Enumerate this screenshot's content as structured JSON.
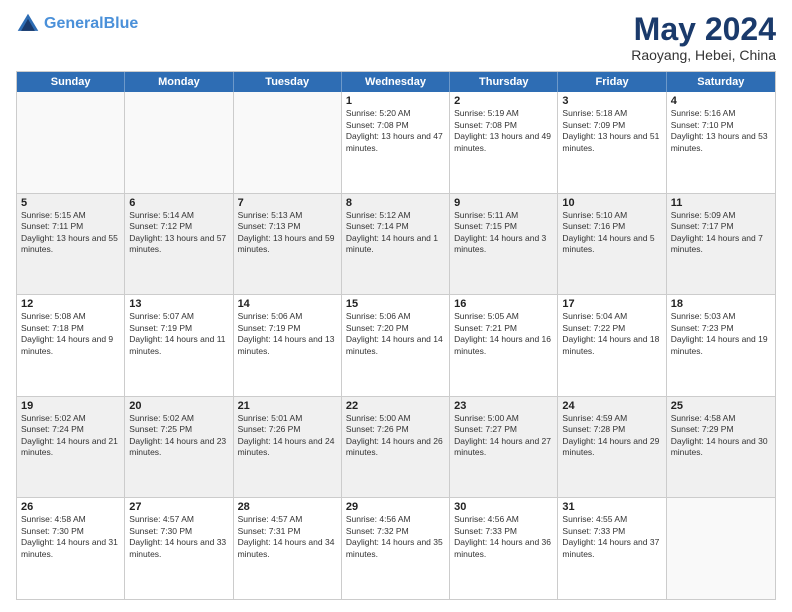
{
  "header": {
    "logo_line1": "General",
    "logo_line2": "Blue",
    "title": "May 2024",
    "subtitle": "Raoyang, Hebei, China"
  },
  "days_of_week": [
    "Sunday",
    "Monday",
    "Tuesday",
    "Wednesday",
    "Thursday",
    "Friday",
    "Saturday"
  ],
  "weeks": [
    [
      {
        "day": "",
        "info": ""
      },
      {
        "day": "",
        "info": ""
      },
      {
        "day": "",
        "info": ""
      },
      {
        "day": "1",
        "info": "Sunrise: 5:20 AM\nSunset: 7:08 PM\nDaylight: 13 hours and 47 minutes."
      },
      {
        "day": "2",
        "info": "Sunrise: 5:19 AM\nSunset: 7:08 PM\nDaylight: 13 hours and 49 minutes."
      },
      {
        "day": "3",
        "info": "Sunrise: 5:18 AM\nSunset: 7:09 PM\nDaylight: 13 hours and 51 minutes."
      },
      {
        "day": "4",
        "info": "Sunrise: 5:16 AM\nSunset: 7:10 PM\nDaylight: 13 hours and 53 minutes."
      }
    ],
    [
      {
        "day": "5",
        "info": "Sunrise: 5:15 AM\nSunset: 7:11 PM\nDaylight: 13 hours and 55 minutes."
      },
      {
        "day": "6",
        "info": "Sunrise: 5:14 AM\nSunset: 7:12 PM\nDaylight: 13 hours and 57 minutes."
      },
      {
        "day": "7",
        "info": "Sunrise: 5:13 AM\nSunset: 7:13 PM\nDaylight: 13 hours and 59 minutes."
      },
      {
        "day": "8",
        "info": "Sunrise: 5:12 AM\nSunset: 7:14 PM\nDaylight: 14 hours and 1 minute."
      },
      {
        "day": "9",
        "info": "Sunrise: 5:11 AM\nSunset: 7:15 PM\nDaylight: 14 hours and 3 minutes."
      },
      {
        "day": "10",
        "info": "Sunrise: 5:10 AM\nSunset: 7:16 PM\nDaylight: 14 hours and 5 minutes."
      },
      {
        "day": "11",
        "info": "Sunrise: 5:09 AM\nSunset: 7:17 PM\nDaylight: 14 hours and 7 minutes."
      }
    ],
    [
      {
        "day": "12",
        "info": "Sunrise: 5:08 AM\nSunset: 7:18 PM\nDaylight: 14 hours and 9 minutes."
      },
      {
        "day": "13",
        "info": "Sunrise: 5:07 AM\nSunset: 7:19 PM\nDaylight: 14 hours and 11 minutes."
      },
      {
        "day": "14",
        "info": "Sunrise: 5:06 AM\nSunset: 7:19 PM\nDaylight: 14 hours and 13 minutes."
      },
      {
        "day": "15",
        "info": "Sunrise: 5:06 AM\nSunset: 7:20 PM\nDaylight: 14 hours and 14 minutes."
      },
      {
        "day": "16",
        "info": "Sunrise: 5:05 AM\nSunset: 7:21 PM\nDaylight: 14 hours and 16 minutes."
      },
      {
        "day": "17",
        "info": "Sunrise: 5:04 AM\nSunset: 7:22 PM\nDaylight: 14 hours and 18 minutes."
      },
      {
        "day": "18",
        "info": "Sunrise: 5:03 AM\nSunset: 7:23 PM\nDaylight: 14 hours and 19 minutes."
      }
    ],
    [
      {
        "day": "19",
        "info": "Sunrise: 5:02 AM\nSunset: 7:24 PM\nDaylight: 14 hours and 21 minutes."
      },
      {
        "day": "20",
        "info": "Sunrise: 5:02 AM\nSunset: 7:25 PM\nDaylight: 14 hours and 23 minutes."
      },
      {
        "day": "21",
        "info": "Sunrise: 5:01 AM\nSunset: 7:26 PM\nDaylight: 14 hours and 24 minutes."
      },
      {
        "day": "22",
        "info": "Sunrise: 5:00 AM\nSunset: 7:26 PM\nDaylight: 14 hours and 26 minutes."
      },
      {
        "day": "23",
        "info": "Sunrise: 5:00 AM\nSunset: 7:27 PM\nDaylight: 14 hours and 27 minutes."
      },
      {
        "day": "24",
        "info": "Sunrise: 4:59 AM\nSunset: 7:28 PM\nDaylight: 14 hours and 29 minutes."
      },
      {
        "day": "25",
        "info": "Sunrise: 4:58 AM\nSunset: 7:29 PM\nDaylight: 14 hours and 30 minutes."
      }
    ],
    [
      {
        "day": "26",
        "info": "Sunrise: 4:58 AM\nSunset: 7:30 PM\nDaylight: 14 hours and 31 minutes."
      },
      {
        "day": "27",
        "info": "Sunrise: 4:57 AM\nSunset: 7:30 PM\nDaylight: 14 hours and 33 minutes."
      },
      {
        "day": "28",
        "info": "Sunrise: 4:57 AM\nSunset: 7:31 PM\nDaylight: 14 hours and 34 minutes."
      },
      {
        "day": "29",
        "info": "Sunrise: 4:56 AM\nSunset: 7:32 PM\nDaylight: 14 hours and 35 minutes."
      },
      {
        "day": "30",
        "info": "Sunrise: 4:56 AM\nSunset: 7:33 PM\nDaylight: 14 hours and 36 minutes."
      },
      {
        "day": "31",
        "info": "Sunrise: 4:55 AM\nSunset: 7:33 PM\nDaylight: 14 hours and 37 minutes."
      },
      {
        "day": "",
        "info": ""
      }
    ]
  ]
}
